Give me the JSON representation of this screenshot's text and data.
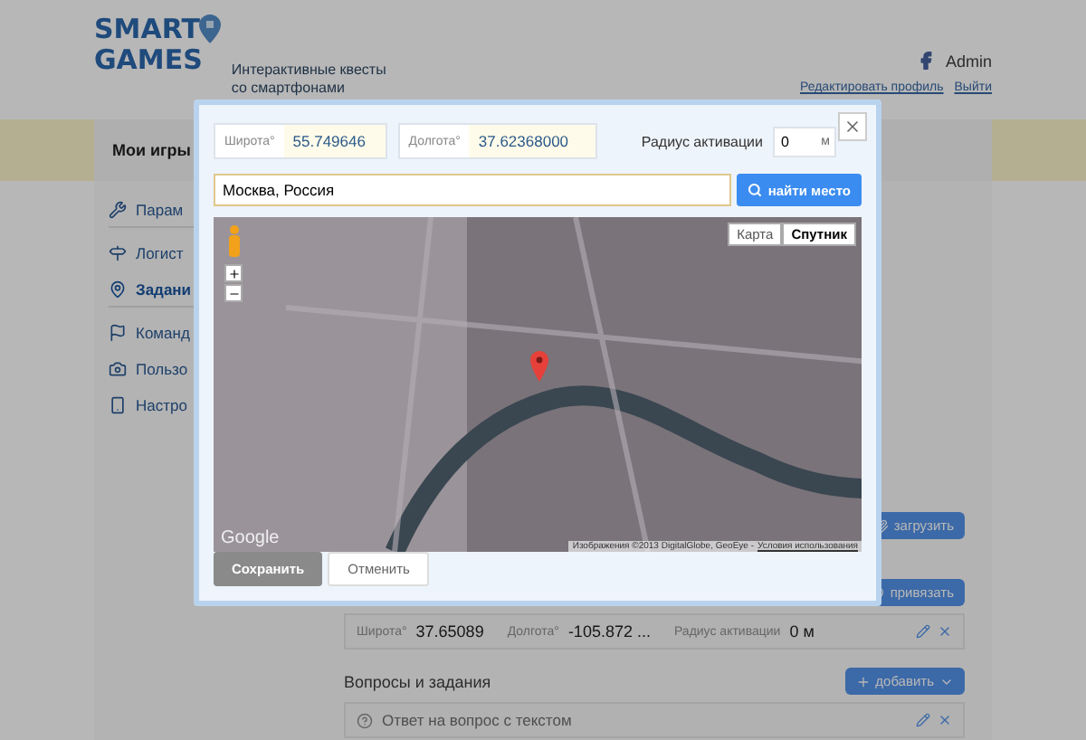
{
  "header": {
    "logo_lines": [
      "SMART",
      "GAMES"
    ],
    "tagline_lines": [
      "Интерактивные квесты",
      "со смартфонами"
    ],
    "user": "Admin",
    "links": [
      "Редактировать профиль",
      "Выйти"
    ]
  },
  "page_title": "Мои игры",
  "sidebar": {
    "items": [
      {
        "label": "Парам",
        "selected": false
      },
      {
        "label": "Логист",
        "selected": false
      },
      {
        "label": "Задани",
        "selected": true
      },
      {
        "label": "Команд",
        "selected": false
      },
      {
        "label": "Пользо",
        "selected": false
      },
      {
        "label": "Настро",
        "selected": false
      }
    ]
  },
  "content": {
    "upload_button": "загрузить",
    "attach_button": "привязать",
    "point": {
      "lat_label": "Широта°",
      "lat": "37.65089",
      "lon_label": "Долгота°",
      "lon": "-105.872 ...",
      "radius_label": "Радиус активации",
      "radius": "0 м"
    },
    "section_title": "Вопросы и задания",
    "add_button": "добавить",
    "tasks": [
      {
        "label": "Ответ на вопрос с текстом"
      }
    ]
  },
  "modal": {
    "lat_label": "Широта°",
    "lat": "55.749646",
    "lon_label": "Долгота°",
    "lon": "37.62368000",
    "radius_label": "Радиус активации",
    "radius": "0",
    "radius_unit": "м",
    "search_value": "Москва, Россия",
    "search_button": "найти место",
    "map": {
      "types": [
        {
          "label": "Карта",
          "selected": false
        },
        {
          "label": "Спутник",
          "selected": true
        }
      ],
      "logo": "Google",
      "attribution": "Изображения ©2013 DigitalGlobe, GeoEye -",
      "terms_link": "Условия использования"
    },
    "save_button": "Сохранить",
    "cancel_button": "Отменить"
  }
}
